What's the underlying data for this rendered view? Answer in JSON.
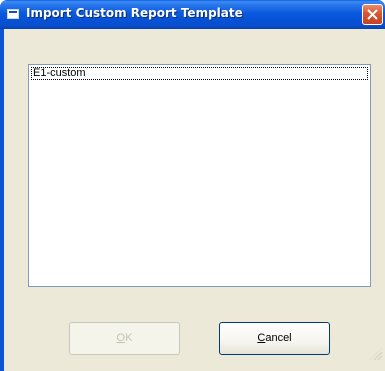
{
  "window": {
    "title": "Import Custom Report Template"
  },
  "templates": {
    "items": [
      "E1-custom"
    ],
    "selected_index": 0
  },
  "buttons": {
    "ok": {
      "mnemonic": "O",
      "rest": "K",
      "enabled": false
    },
    "cancel": {
      "mnemonic": "C",
      "rest": "ancel",
      "enabled": true
    }
  },
  "icons": {
    "window": "app-window-icon",
    "close": "close-x-icon",
    "grip": "resize-grip-icon"
  },
  "colors": {
    "titlebar": "#0552d6",
    "close_button": "#d5572f",
    "client_background": "#ece9d8",
    "list_border": "#7f9db9",
    "button_border_default": "#003c74"
  }
}
